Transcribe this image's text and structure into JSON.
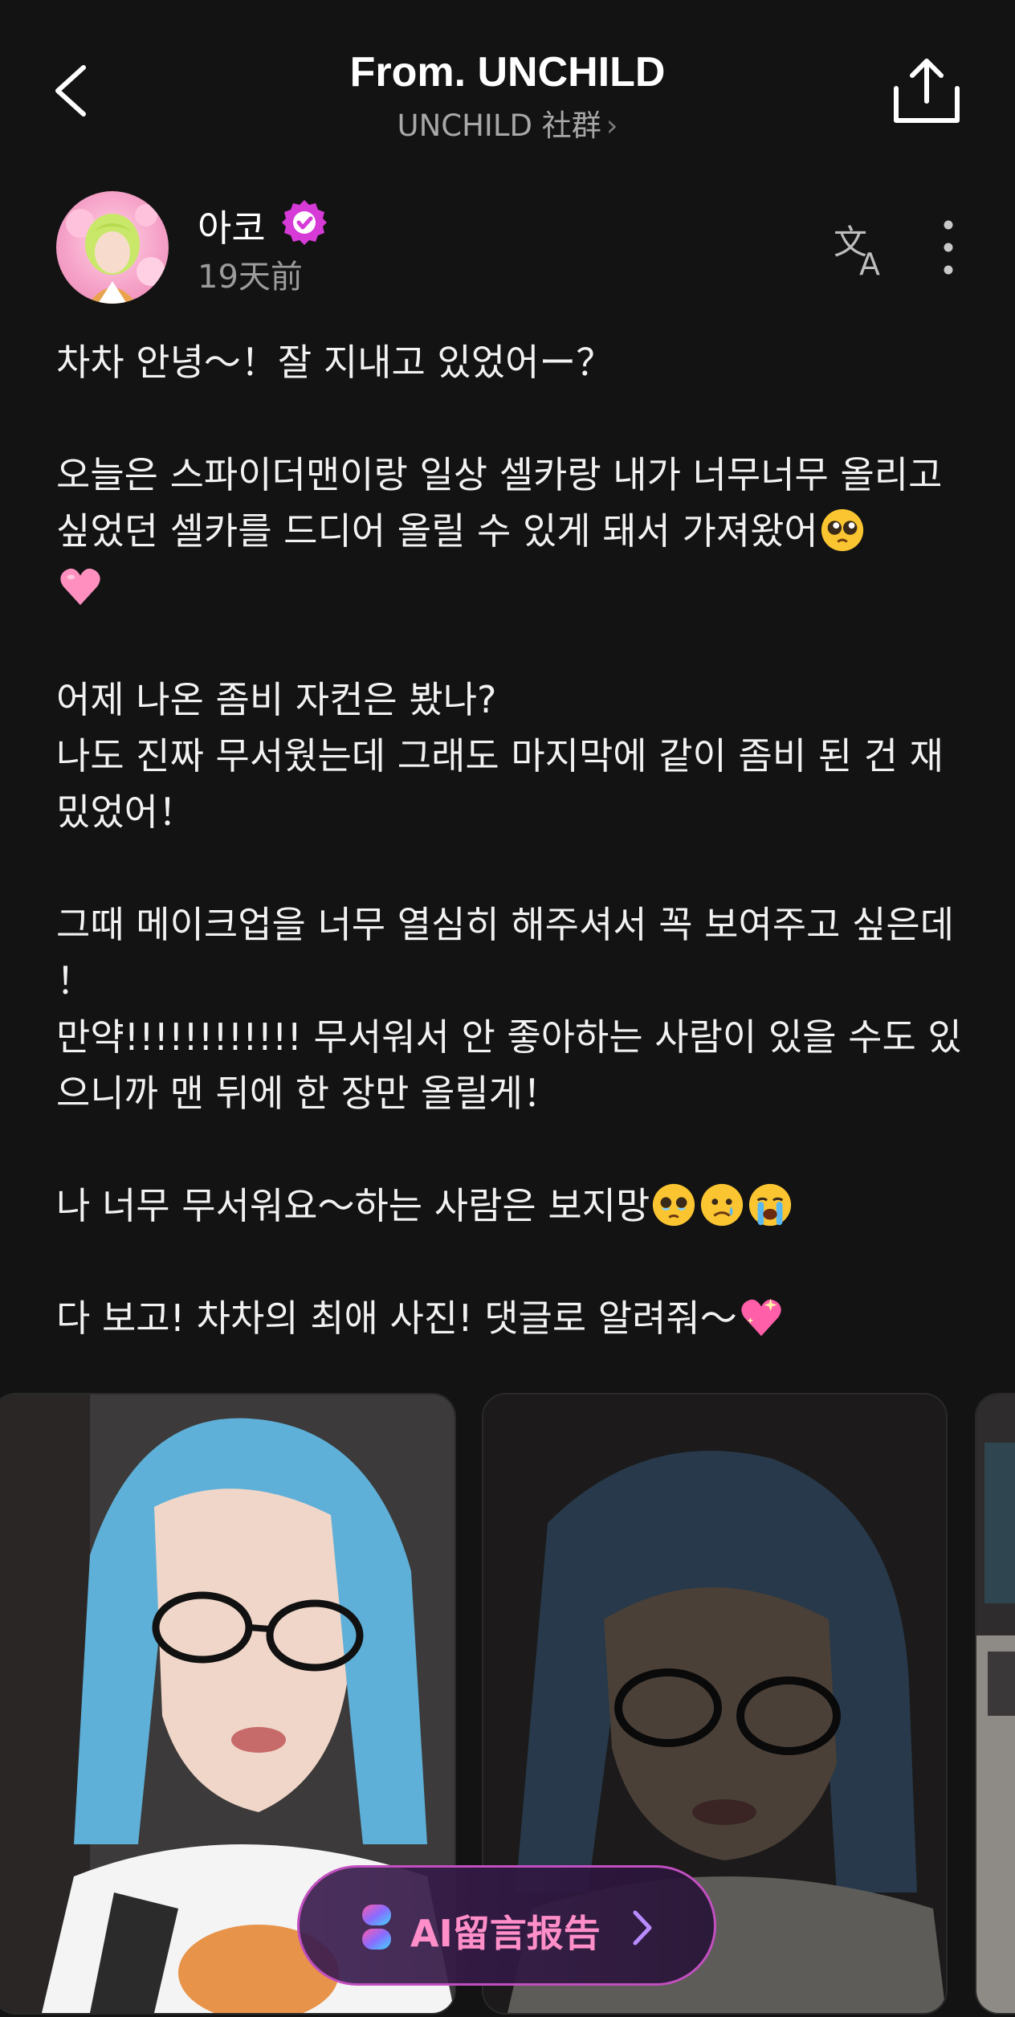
{
  "header": {
    "title": "From. UNCHILD",
    "subtitle": "UNCHILD 社群",
    "subtitle_chevron": "›"
  },
  "author": {
    "name": "아코",
    "time": "19天前",
    "verified_color": "#d63ad7"
  },
  "post": {
    "paragraphs": [
      "차차 안녕～！잘 지내고 있었어ー？",
      "오늘은 스파이더맨이랑 일상 셀카랑 내가 너무너무 올리고 싶었던 셀카를 드디어 올릴 수 있게 돼서 가져왔어",
      "어제 나온 좀비 자컨은 봤나?",
      "나도 진짜 무서웠는데 그래도 마지막에 같이 좀비 된 건 재밌었어！",
      "그때 메이크업을 너무 열심히 해주셔서 꼭 보여주고 싶은데 ！",
      "만약!!!!!!!!!!!! 무서워서 안 좋아하는 사람이 있을 수도 있으니까 맨 뒤에 한 장만 올릴게！",
      "나 너무 무서워요～하는 사람은 보지망",
      "다 보고! 차차의 최애 사진! 댓글로 알려줘～"
    ]
  },
  "icons": {
    "back": "chevron-left-icon",
    "share": "share-icon",
    "translate": "translate-icon",
    "more": "more-vertical-icon",
    "pleading_face": "pleading-face-emoji",
    "pink_heart": "pink-heart-emoji",
    "holding_back_tears": "face-holding-back-tears-emoji",
    "sad_face": "sad-but-relieved-emoji",
    "crying_face": "loudly-crying-face-emoji",
    "sparkling_heart": "sparkling-heart-emoji"
  },
  "ai_report": {
    "label": "AI留言报告",
    "chevron": "›",
    "accent": "#ff8ec9"
  }
}
